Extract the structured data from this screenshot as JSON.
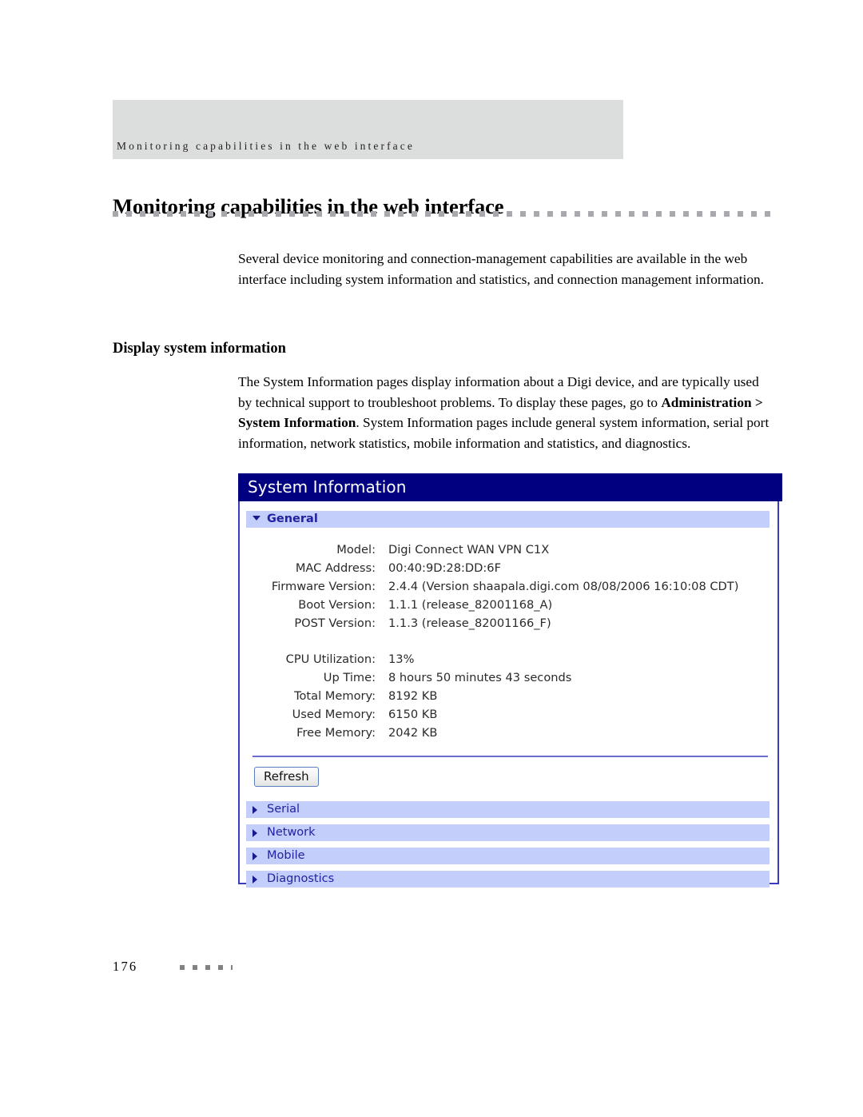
{
  "page": {
    "running_header": "Monitoring capabilities in the web interface",
    "title": "Monitoring capabilities in the web interface",
    "folio": "176"
  },
  "content": {
    "intro_paragraph": "Several device monitoring and connection-management capabilities are available in the web interface including system information and statistics, and connection management information.",
    "section_heading": "Display system information",
    "section_paragraph_part1": "The System Information pages display information about a Digi device, and are typically used by technical support to troubleshoot problems. To display these pages, go to ",
    "section_paragraph_bold": "Administration > System Information",
    "section_paragraph_part2": ". System Information pages include general system information, serial port information, network statistics, mobile information and statistics, and diagnostics."
  },
  "screenshot": {
    "window_title": "System Information",
    "general_section": {
      "label": "General",
      "expanded_icon": "chevron-down-icon",
      "rows_group1": [
        {
          "label": "Model:",
          "value": "Digi Connect WAN VPN C1X"
        },
        {
          "label": "MAC Address:",
          "value": "00:40:9D:28:DD:6F"
        },
        {
          "label": "Firmware Version:",
          "value": "2.4.4  (Version shaapala.digi.com 08/08/2006 16:10:08 CDT)"
        },
        {
          "label": "Boot Version:",
          "value": "1.1.1  (release_82001168_A)"
        },
        {
          "label": "POST Version:",
          "value": "1.1.3  (release_82001166_F)"
        }
      ],
      "rows_group2": [
        {
          "label": "CPU Utilization:",
          "value": "13%"
        },
        {
          "label": "Up Time:",
          "value": "8 hours 50 minutes 43 seconds"
        },
        {
          "label": "Total Memory:",
          "value": "8192 KB"
        },
        {
          "label": "Used Memory:",
          "value": "6150 KB"
        },
        {
          "label": "Free Memory:",
          "value": "2042 KB"
        }
      ],
      "refresh_label": "Refresh"
    },
    "collapsed_sections": [
      {
        "label": "Serial",
        "icon": "chevron-right-icon"
      },
      {
        "label": "Network",
        "icon": "chevron-right-icon"
      },
      {
        "label": "Mobile",
        "icon": "chevron-right-icon"
      },
      {
        "label": "Diagnostics",
        "icon": "chevron-right-icon"
      }
    ],
    "colors": {
      "titlebar_background": "#000080",
      "titlebar_text": "#ffffff",
      "section_bar_background": "#c3cffa",
      "section_bar_text": "#2222a0",
      "panel_border": "#3b3bbd",
      "rule": "#6b6bcf"
    }
  }
}
